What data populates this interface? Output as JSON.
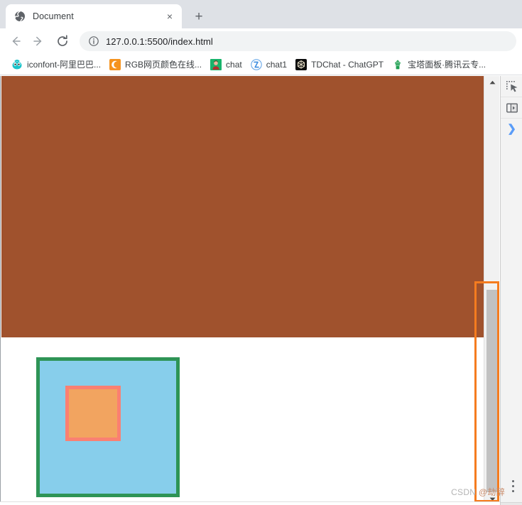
{
  "window": {
    "tab": {
      "favicon": "globe-icon",
      "title": "Document",
      "close_label": "×"
    },
    "new_tab_label": "+"
  },
  "toolbar": {
    "back_icon": "arrow-left-icon",
    "forward_icon": "arrow-right-icon",
    "reload_icon": "reload-icon",
    "site_info_icon": "info-circle-icon",
    "url": "127.0.0.1:5500/index.html"
  },
  "bookmarks": [
    {
      "icon": "iconfont-logo-icon",
      "label": "iconfont-阿里巴巴...",
      "icon_color": "#2aa9b8"
    },
    {
      "icon": "rgb-tool-icon",
      "label": "RGB网页颜色在线...",
      "icon_color": "#f5931e"
    },
    {
      "icon": "chat-avatar-icon",
      "label": "chat",
      "icon_color": "#19b36b"
    },
    {
      "icon": "chat1-icon",
      "label": "chat1",
      "icon_color": "#3f8ee0"
    },
    {
      "icon": "tdchat-icon",
      "label": "TDChat - ChatGPT",
      "icon_color": "#1c1c1c"
    },
    {
      "icon": "baota-panel-icon",
      "label": "宝塔面板·腾讯云专...",
      "icon_color": "#20a052"
    }
  ],
  "page": {
    "blocks": {
      "header_block": {
        "name": "brown-banner",
        "color": "#a0522d"
      },
      "outer_box": {
        "name": "green-bordered-box",
        "background": "#87ceeb",
        "border_color": "#2e9456",
        "border_width": "5px"
      },
      "inner_box": {
        "name": "orange-inner-box",
        "background": "#f2a460",
        "border_color": "#fa8072",
        "border_width": "5px"
      }
    }
  },
  "scrollbar": {
    "up_arrow_icon": "scroll-up-arrow-icon",
    "down_arrow_icon": "scroll-down-arrow-icon",
    "thumb_color": "#c1c1c1",
    "track_color": "#f1f1f1"
  },
  "devtools": {
    "inspect_icon": "element-picker-icon",
    "device_toolbar_icon": "device-toolbar-icon",
    "expand_icon": "chevron-right-icon",
    "more_icon": "kebab-menu-icon"
  },
  "annotation": {
    "name": "scrollbar-highlight-rect",
    "color": "#f57c1f"
  },
  "watermark": {
    "site": "CSDN ",
    "user": "@劫辞"
  }
}
